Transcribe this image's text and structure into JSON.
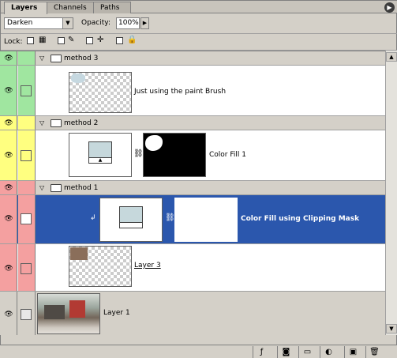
{
  "tabs": [
    {
      "label": "Layers",
      "active": true
    },
    {
      "label": "Channels",
      "active": false
    },
    {
      "label": "Paths",
      "active": false
    }
  ],
  "panel_menu_icon": "menu-arrow-icon",
  "options": {
    "blend_mode": "Darken",
    "opacity_label": "Opacity:",
    "opacity_value": "100%"
  },
  "lock": {
    "label": "Lock:",
    "icons": [
      "lock-transparency-icon",
      "lock-image-icon",
      "lock-position-icon",
      "lock-all-icon"
    ]
  },
  "groups": [
    {
      "name": "method 3",
      "color": "#a0e6a0",
      "layer": {
        "name": "Just using the paint Brush"
      }
    },
    {
      "name": "method 2",
      "color": "#ffff80",
      "layer": {
        "name": "Color Fill 1"
      }
    },
    {
      "name": "method 1",
      "color": "#f4a0a0",
      "layers": [
        {
          "name": "Color Fill using Clipping Mask",
          "selected": true
        },
        {
          "name": "Layer 3",
          "underline": true
        }
      ]
    }
  ],
  "base_layer": {
    "name": "Layer 1"
  },
  "toolbar": {
    "icons": [
      "layer-style-icon",
      "mask-icon",
      "new-group-icon",
      "adjustment-layer-icon",
      "new-layer-icon",
      "trash-icon"
    ]
  },
  "colors": {
    "selection": "#2b57ad",
    "panel": "#d4d0c8"
  }
}
